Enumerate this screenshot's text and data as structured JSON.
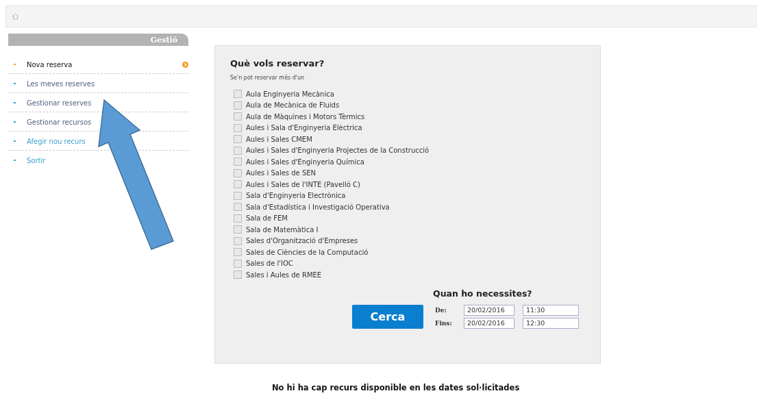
{
  "sidebar": {
    "title": "Gestió",
    "items": [
      {
        "label": "Nova reserva",
        "selected": true,
        "visited": false
      },
      {
        "label": "Les meves reserves",
        "selected": false,
        "visited": true
      },
      {
        "label": "Gestionar reserves",
        "selected": false,
        "visited": true
      },
      {
        "label": "Gestionar recursos",
        "selected": false,
        "visited": true
      },
      {
        "label": "Afegir nou recurs",
        "selected": false,
        "visited": false
      },
      {
        "label": "Sortir",
        "selected": false,
        "visited": false
      }
    ]
  },
  "form": {
    "title": "Què vols reservar?",
    "hint": "Se'n pot reservar més d'un",
    "resources": [
      {
        "label": "Aula Enginyeria Mecànica",
        "checked": false
      },
      {
        "label": "Aula de Mecànica de Fluids",
        "checked": false
      },
      {
        "label": "Aula de Màquines i Motors Tèrmics",
        "checked": false
      },
      {
        "label": "Aules i Sala d'Enginyeria Elèctrica",
        "checked": false
      },
      {
        "label": "Aules i Sales CMEM",
        "checked": false
      },
      {
        "label": "Aules i Sales d'Enginyeria Projectes de la Construcció",
        "checked": false
      },
      {
        "label": "Aules i Sales d'Enginyeria Química",
        "checked": false
      },
      {
        "label": "Aules i Sales de SEN",
        "checked": false
      },
      {
        "label": "Aules i Sales de l'INTE (Pavelló C)",
        "checked": false
      },
      {
        "label": "Sala d'Enginyeria Electrònica",
        "checked": false
      },
      {
        "label": "Sala d'Estadística i Investigació Operativa",
        "checked": false
      },
      {
        "label": "Sala de FEM",
        "checked": false
      },
      {
        "label": "Sala de Matemàtica I",
        "checked": false
      },
      {
        "label": "Sales d'Organització d'Empreses",
        "checked": false
      },
      {
        "label": "Sales de Ciències de la Computació",
        "checked": false
      },
      {
        "label": "Sales de l'IOC",
        "checked": false
      },
      {
        "label": "Sales i Aules de RMEE",
        "checked": false
      }
    ],
    "when_title": "Quan ho necessites?",
    "ranges": [
      {
        "label": "De:",
        "date": "20/02/2016",
        "time": "11:30"
      },
      {
        "label": "Fins:",
        "date": "20/02/2016",
        "time": "12:30"
      }
    ],
    "search_button": "Cerca"
  },
  "message": "No hi ha cap recurs disponible en les dates sol·licitades"
}
